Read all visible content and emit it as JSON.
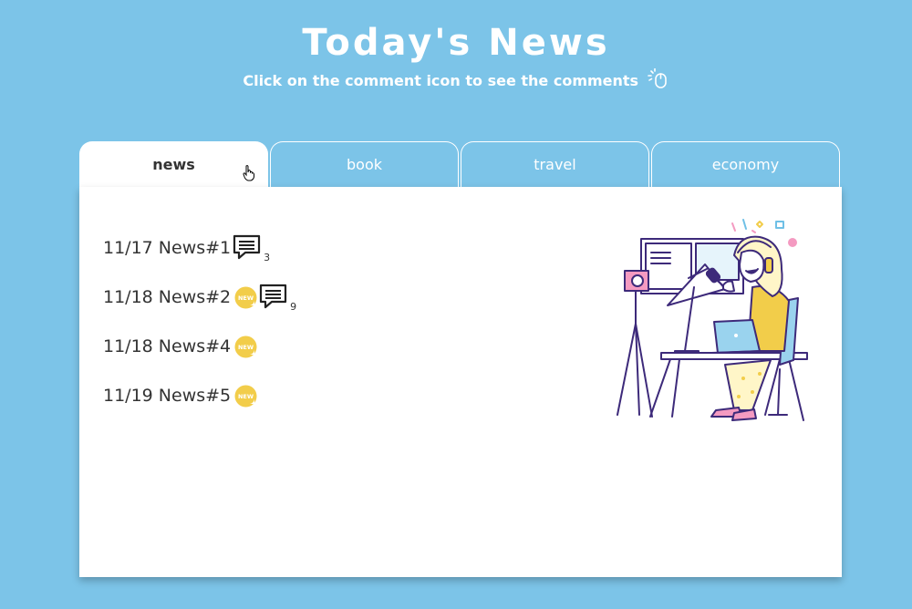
{
  "header": {
    "title": "Today's News",
    "subtitle": "Click on the comment icon to see the comments",
    "subtitle_icon": "mouse-click-icon"
  },
  "tabs": [
    {
      "label": "news",
      "active": true
    },
    {
      "label": "book",
      "active": false
    },
    {
      "label": "travel",
      "active": false
    },
    {
      "label": "economy",
      "active": false
    }
  ],
  "news": [
    {
      "label": "11/17 News#1",
      "is_new": false,
      "comments": "3"
    },
    {
      "label": "11/18 News#2",
      "is_new": true,
      "comments": "9"
    },
    {
      "label": "11/18 News#4",
      "is_new": true,
      "comments": null
    },
    {
      "label": "11/19 News#5",
      "is_new": true,
      "comments": null
    }
  ],
  "badge_text": "NEW",
  "colors": {
    "background": "#7cc4e8",
    "panel": "#ffffff",
    "new_badge": "#f2cd4a",
    "text": "#333333",
    "illustration_line": "#3d2a7a",
    "illustration_accent": "#f2cd4a"
  },
  "illustration": "woman-streaming-at-desk-illustration"
}
